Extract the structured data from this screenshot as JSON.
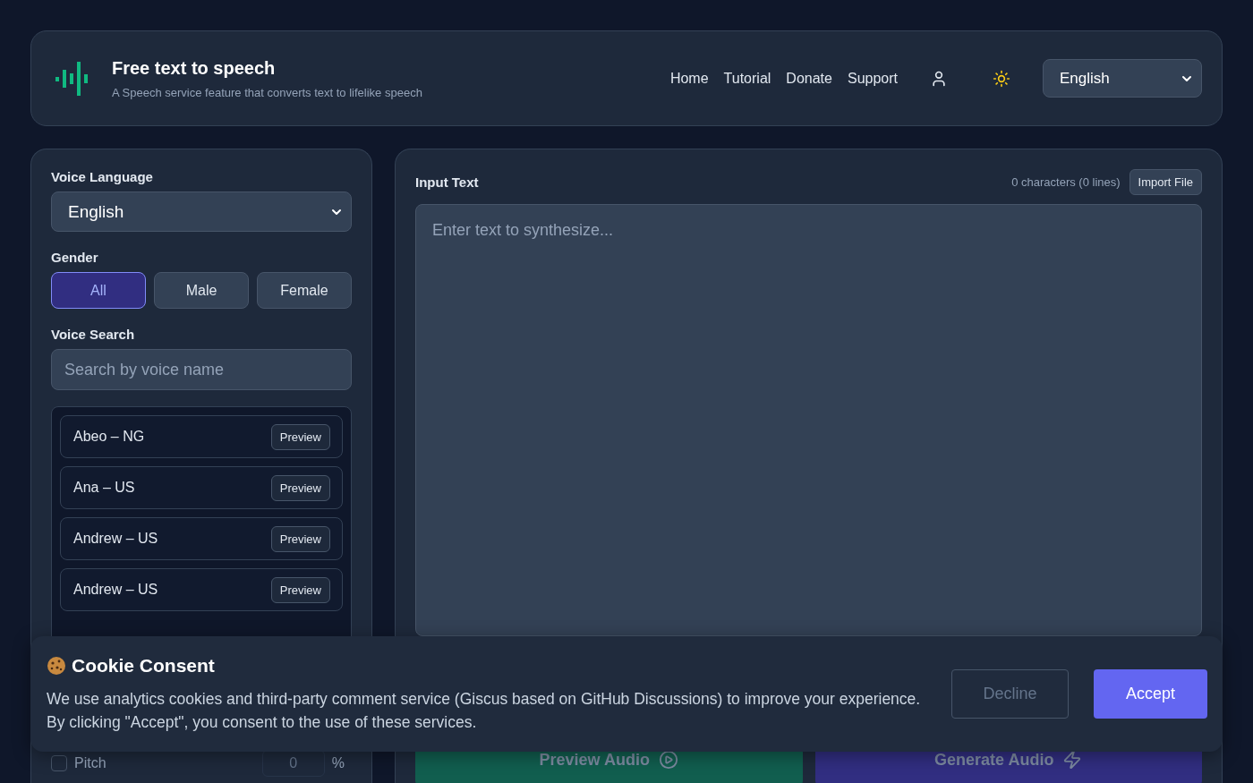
{
  "header": {
    "title": "Free text to speech",
    "subtitle": "A Speech service feature that converts text to lifelike speech",
    "nav": [
      "Home",
      "Tutorial",
      "Donate",
      "Support"
    ],
    "language": "English"
  },
  "voice_panel": {
    "language_label": "Voice Language",
    "language": "English",
    "gender_label": "Gender",
    "genders": [
      {
        "label": "All",
        "selected": true
      },
      {
        "label": "Male",
        "selected": false
      },
      {
        "label": "Female",
        "selected": false
      }
    ],
    "search_label": "Voice Search",
    "search_placeholder": "Search by voice name",
    "voices": [
      {
        "name": "Abeo – NG",
        "button": "Preview"
      },
      {
        "name": "Ana – US",
        "button": "Preview"
      },
      {
        "name": "Andrew – US",
        "button": "Preview"
      },
      {
        "name": "Andrew – US",
        "button": "Preview"
      }
    ],
    "pitch": {
      "label": "Pitch",
      "checked": false,
      "value": "0",
      "unit": "%"
    }
  },
  "input_panel": {
    "title": "Input Text",
    "count": "0 characters (0 lines)",
    "import_button": "Import File",
    "placeholder": "Enter text to synthesize...",
    "actions": [
      {
        "kind": "preview",
        "label": "Preview Audio",
        "disabled": true
      },
      {
        "kind": "generate",
        "label": "Generate Audio",
        "disabled": true
      }
    ]
  },
  "cookie_banner": {
    "title": "Cookie Consent",
    "text": "We use analytics cookies and third-party comment service (Giscus based on GitHub Discussions) to improve your experience. By clicking \"Accept\", you consent to the use of these services.",
    "decline": "Decline",
    "accept": "Accept"
  }
}
